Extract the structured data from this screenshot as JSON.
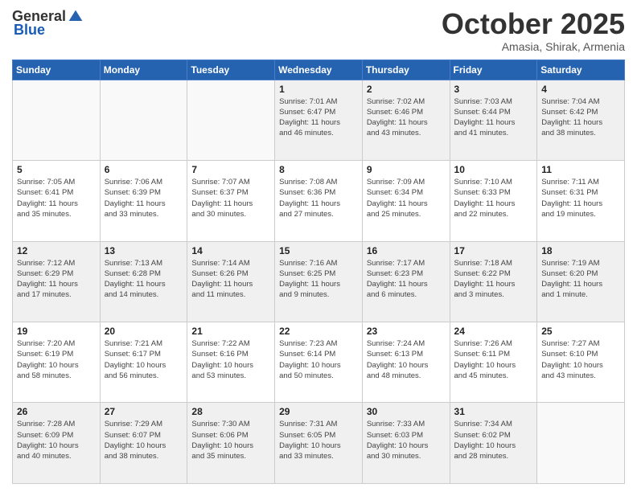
{
  "header": {
    "logo_general": "General",
    "logo_blue": "Blue",
    "month_title": "October 2025",
    "subtitle": "Amasia, Shirak, Armenia"
  },
  "days_of_week": [
    "Sunday",
    "Monday",
    "Tuesday",
    "Wednesday",
    "Thursday",
    "Friday",
    "Saturday"
  ],
  "weeks": [
    [
      {
        "day": null,
        "info": null
      },
      {
        "day": null,
        "info": null
      },
      {
        "day": null,
        "info": null
      },
      {
        "day": "1",
        "info": "Sunrise: 7:01 AM\nSunset: 6:47 PM\nDaylight: 11 hours\nand 46 minutes."
      },
      {
        "day": "2",
        "info": "Sunrise: 7:02 AM\nSunset: 6:46 PM\nDaylight: 11 hours\nand 43 minutes."
      },
      {
        "day": "3",
        "info": "Sunrise: 7:03 AM\nSunset: 6:44 PM\nDaylight: 11 hours\nand 41 minutes."
      },
      {
        "day": "4",
        "info": "Sunrise: 7:04 AM\nSunset: 6:42 PM\nDaylight: 11 hours\nand 38 minutes."
      }
    ],
    [
      {
        "day": "5",
        "info": "Sunrise: 7:05 AM\nSunset: 6:41 PM\nDaylight: 11 hours\nand 35 minutes."
      },
      {
        "day": "6",
        "info": "Sunrise: 7:06 AM\nSunset: 6:39 PM\nDaylight: 11 hours\nand 33 minutes."
      },
      {
        "day": "7",
        "info": "Sunrise: 7:07 AM\nSunset: 6:37 PM\nDaylight: 11 hours\nand 30 minutes."
      },
      {
        "day": "8",
        "info": "Sunrise: 7:08 AM\nSunset: 6:36 PM\nDaylight: 11 hours\nand 27 minutes."
      },
      {
        "day": "9",
        "info": "Sunrise: 7:09 AM\nSunset: 6:34 PM\nDaylight: 11 hours\nand 25 minutes."
      },
      {
        "day": "10",
        "info": "Sunrise: 7:10 AM\nSunset: 6:33 PM\nDaylight: 11 hours\nand 22 minutes."
      },
      {
        "day": "11",
        "info": "Sunrise: 7:11 AM\nSunset: 6:31 PM\nDaylight: 11 hours\nand 19 minutes."
      }
    ],
    [
      {
        "day": "12",
        "info": "Sunrise: 7:12 AM\nSunset: 6:29 PM\nDaylight: 11 hours\nand 17 minutes."
      },
      {
        "day": "13",
        "info": "Sunrise: 7:13 AM\nSunset: 6:28 PM\nDaylight: 11 hours\nand 14 minutes."
      },
      {
        "day": "14",
        "info": "Sunrise: 7:14 AM\nSunset: 6:26 PM\nDaylight: 11 hours\nand 11 minutes."
      },
      {
        "day": "15",
        "info": "Sunrise: 7:16 AM\nSunset: 6:25 PM\nDaylight: 11 hours\nand 9 minutes."
      },
      {
        "day": "16",
        "info": "Sunrise: 7:17 AM\nSunset: 6:23 PM\nDaylight: 11 hours\nand 6 minutes."
      },
      {
        "day": "17",
        "info": "Sunrise: 7:18 AM\nSunset: 6:22 PM\nDaylight: 11 hours\nand 3 minutes."
      },
      {
        "day": "18",
        "info": "Sunrise: 7:19 AM\nSunset: 6:20 PM\nDaylight: 11 hours\nand 1 minute."
      }
    ],
    [
      {
        "day": "19",
        "info": "Sunrise: 7:20 AM\nSunset: 6:19 PM\nDaylight: 10 hours\nand 58 minutes."
      },
      {
        "day": "20",
        "info": "Sunrise: 7:21 AM\nSunset: 6:17 PM\nDaylight: 10 hours\nand 56 minutes."
      },
      {
        "day": "21",
        "info": "Sunrise: 7:22 AM\nSunset: 6:16 PM\nDaylight: 10 hours\nand 53 minutes."
      },
      {
        "day": "22",
        "info": "Sunrise: 7:23 AM\nSunset: 6:14 PM\nDaylight: 10 hours\nand 50 minutes."
      },
      {
        "day": "23",
        "info": "Sunrise: 7:24 AM\nSunset: 6:13 PM\nDaylight: 10 hours\nand 48 minutes."
      },
      {
        "day": "24",
        "info": "Sunrise: 7:26 AM\nSunset: 6:11 PM\nDaylight: 10 hours\nand 45 minutes."
      },
      {
        "day": "25",
        "info": "Sunrise: 7:27 AM\nSunset: 6:10 PM\nDaylight: 10 hours\nand 43 minutes."
      }
    ],
    [
      {
        "day": "26",
        "info": "Sunrise: 7:28 AM\nSunset: 6:09 PM\nDaylight: 10 hours\nand 40 minutes."
      },
      {
        "day": "27",
        "info": "Sunrise: 7:29 AM\nSunset: 6:07 PM\nDaylight: 10 hours\nand 38 minutes."
      },
      {
        "day": "28",
        "info": "Sunrise: 7:30 AM\nSunset: 6:06 PM\nDaylight: 10 hours\nand 35 minutes."
      },
      {
        "day": "29",
        "info": "Sunrise: 7:31 AM\nSunset: 6:05 PM\nDaylight: 10 hours\nand 33 minutes."
      },
      {
        "day": "30",
        "info": "Sunrise: 7:33 AM\nSunset: 6:03 PM\nDaylight: 10 hours\nand 30 minutes."
      },
      {
        "day": "31",
        "info": "Sunrise: 7:34 AM\nSunset: 6:02 PM\nDaylight: 10 hours\nand 28 minutes."
      },
      {
        "day": null,
        "info": null
      }
    ]
  ]
}
